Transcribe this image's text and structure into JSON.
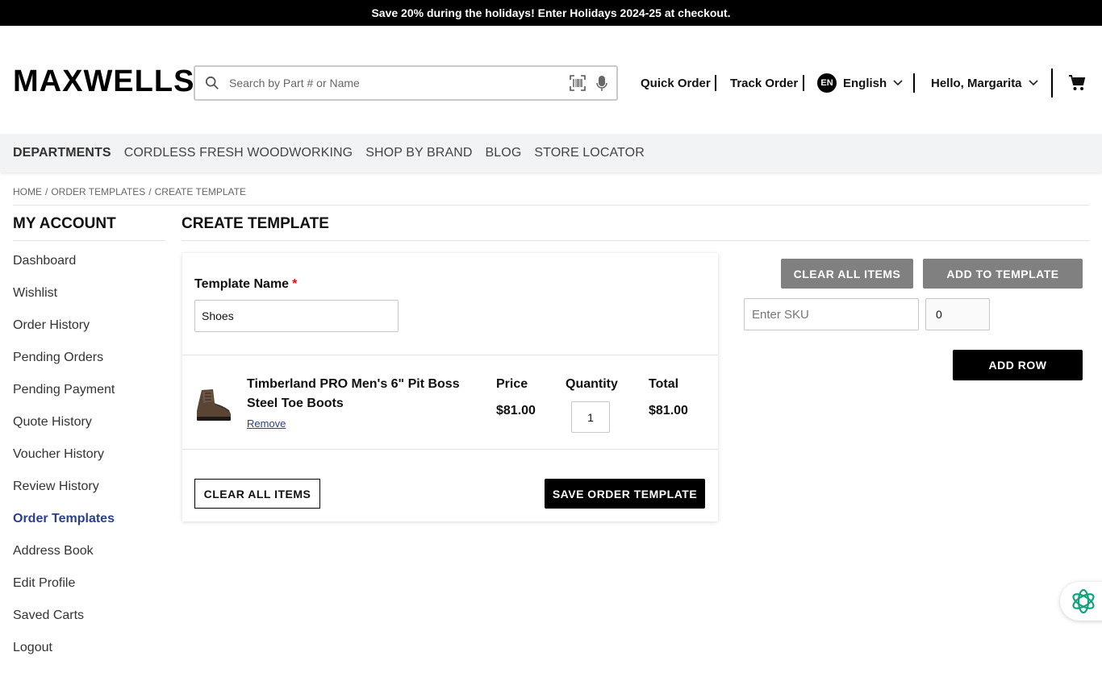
{
  "promo": {
    "text": "Save 20% during the holidays! Enter Holidays 2024-25 at checkout."
  },
  "header": {
    "logo": "MAXWELLS",
    "search_placeholder": "Search by Part # or Name",
    "quick_order": "Quick Order",
    "track_order": "Track Order",
    "lang_code": "EN",
    "lang_label": "English",
    "user_greeting": "Hello, Margarita"
  },
  "nav": {
    "items": [
      "DEPARTMENTS",
      "CORDLESS FRESH WOODWORKING",
      "SHOP BY BRAND",
      "BLOG",
      "STORE LOCATOR"
    ]
  },
  "breadcrumb": {
    "items": [
      "HOME",
      "ORDER TEMPLATES",
      "CREATE TEMPLATE"
    ],
    "separator": "/"
  },
  "sidebar": {
    "title": "MY ACCOUNT",
    "items": [
      "Dashboard",
      "Wishlist",
      "Order History",
      "Pending Orders",
      "Pending Payment",
      "Quote History",
      "Voucher History",
      "Review History",
      "Order Templates",
      "Address Book",
      "Edit Profile",
      "Saved Carts",
      "Logout"
    ],
    "active": "Order Templates"
  },
  "main": {
    "title": "CREATE TEMPLATE",
    "template_name_label": "Template Name",
    "required_mark": "*",
    "template_name_value": "Shoes",
    "columns": {
      "price": "Price",
      "quantity": "Quantity",
      "total": "Total"
    },
    "item": {
      "name": "Timberland PRO Men's 6\" Pit Boss Steel Toe Boots",
      "remove": "Remove",
      "price": "$81.00",
      "quantity": "1",
      "total": "$81.00"
    },
    "clear_all_label": "CLEAR ALL ITEMS",
    "save_label": "SAVE ORDER TEMPLATE"
  },
  "quick_add": {
    "clear_all_label": "CLEAR ALL ITEMS",
    "add_to_template_label": "ADD TO TEMPLATE",
    "sku_placeholder": "Enter SKU",
    "qty_value": "0",
    "add_row_label": "ADD ROW"
  },
  "colors": {
    "active_link": "#2a3f8f",
    "required": "#dd1111",
    "chat_accent": "#10a37f"
  },
  "icons": [
    "search-icon",
    "barcode-scan-icon",
    "microphone-icon",
    "chevron-down-icon",
    "cart-icon",
    "chat-assistant-icon"
  ]
}
